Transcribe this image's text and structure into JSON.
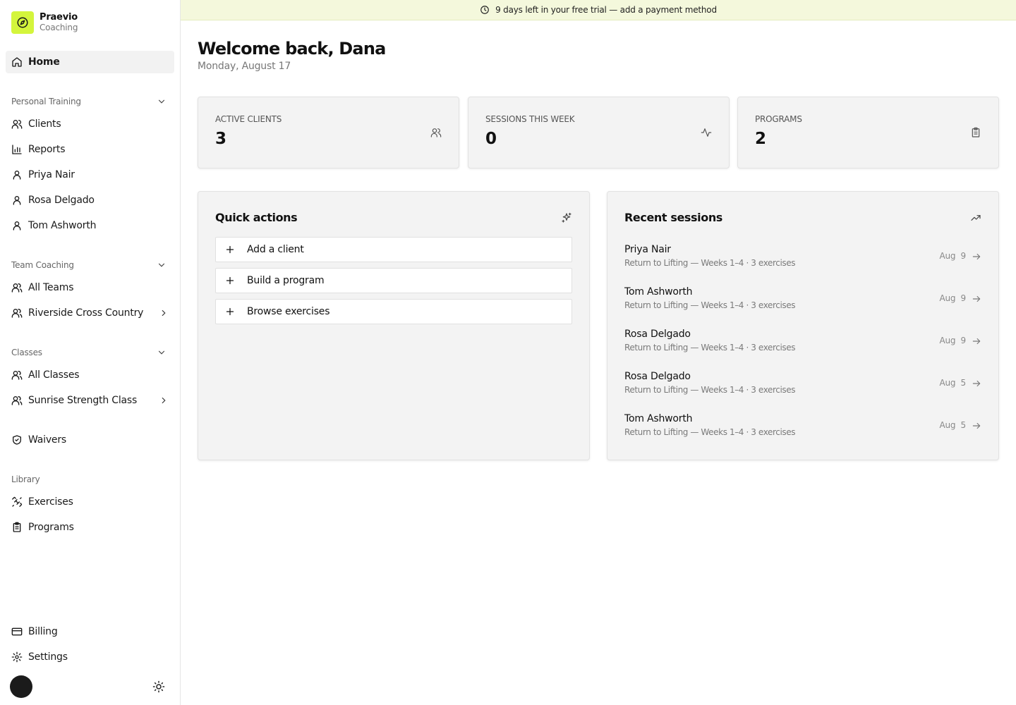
{
  "brand": {
    "name": "Praevio",
    "subtitle": "Coaching",
    "accent": "#d4f53c"
  },
  "banner": {
    "text": "9 days left in your free trial — add a payment method"
  },
  "sidebar": {
    "home": "Home",
    "personal_training": {
      "label": "Personal Training",
      "items": [
        "Clients",
        "Reports",
        "Priya Nair",
        "Rosa Delgado",
        "Tom Ashworth"
      ]
    },
    "team_coaching": {
      "label": "Team Coaching",
      "items": [
        "All Teams",
        "Riverside Cross Country"
      ]
    },
    "classes": {
      "label": "Classes",
      "items": [
        "All Classes",
        "Sunrise Strength Class"
      ]
    },
    "waivers": "Waivers",
    "library": {
      "label": "Library",
      "items": [
        "Exercises",
        "Programs"
      ]
    },
    "billing": "Billing",
    "settings": "Settings"
  },
  "header": {
    "title": "Welcome back, Dana",
    "date": "Monday, August 17"
  },
  "stats": [
    {
      "label": "ACTIVE CLIENTS",
      "value": "3",
      "icon": "users-icon"
    },
    {
      "label": "SESSIONS THIS WEEK",
      "value": "0",
      "icon": "activity-icon"
    },
    {
      "label": "PROGRAMS",
      "value": "2",
      "icon": "clipboard-icon"
    }
  ],
  "quick_actions": {
    "title": "Quick actions",
    "items": [
      "Add a client",
      "Build a program",
      "Browse exercises"
    ]
  },
  "recent_sessions": {
    "title": "Recent sessions",
    "items": [
      {
        "name": "Priya Nair",
        "detail": "Return to Lifting — Weeks 1–4 · 3 exercises",
        "date": "Aug  9"
      },
      {
        "name": "Tom Ashworth",
        "detail": "Return to Lifting — Weeks 1–4 · 3 exercises",
        "date": "Aug  9"
      },
      {
        "name": "Rosa Delgado",
        "detail": "Return to Lifting — Weeks 1–4 · 3 exercises",
        "date": "Aug  9"
      },
      {
        "name": "Rosa Delgado",
        "detail": "Return to Lifting — Weeks 1–4 · 3 exercises",
        "date": "Aug  5"
      },
      {
        "name": "Tom Ashworth",
        "detail": "Return to Lifting — Weeks 1–4 · 3 exercises",
        "date": "Aug  5"
      }
    ]
  }
}
